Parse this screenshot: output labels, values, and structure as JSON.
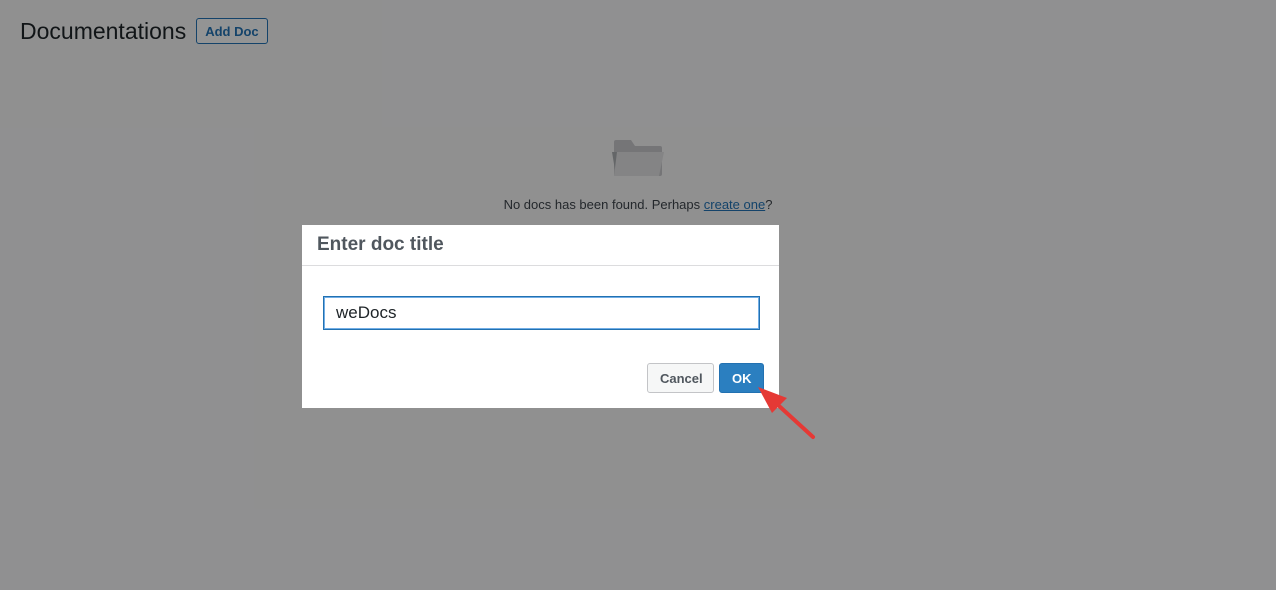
{
  "page": {
    "title": "Documentations",
    "add_doc_label": "Add Doc"
  },
  "empty_state": {
    "icon": "folder-icon",
    "message_prefix": "No docs has been found. Perhaps ",
    "link_text": "create one",
    "message_suffix": "?"
  },
  "dialog": {
    "title": "Enter doc title",
    "input_value": "weDocs",
    "cancel_label": "Cancel",
    "ok_label": "OK"
  },
  "annotation": {
    "icon": "red-arrow-icon",
    "color": "#e53935"
  },
  "colors": {
    "accent": "#2271b1",
    "ok_button": "#2b7fc0",
    "overlay": "rgba(0,0,0,0.4)"
  }
}
